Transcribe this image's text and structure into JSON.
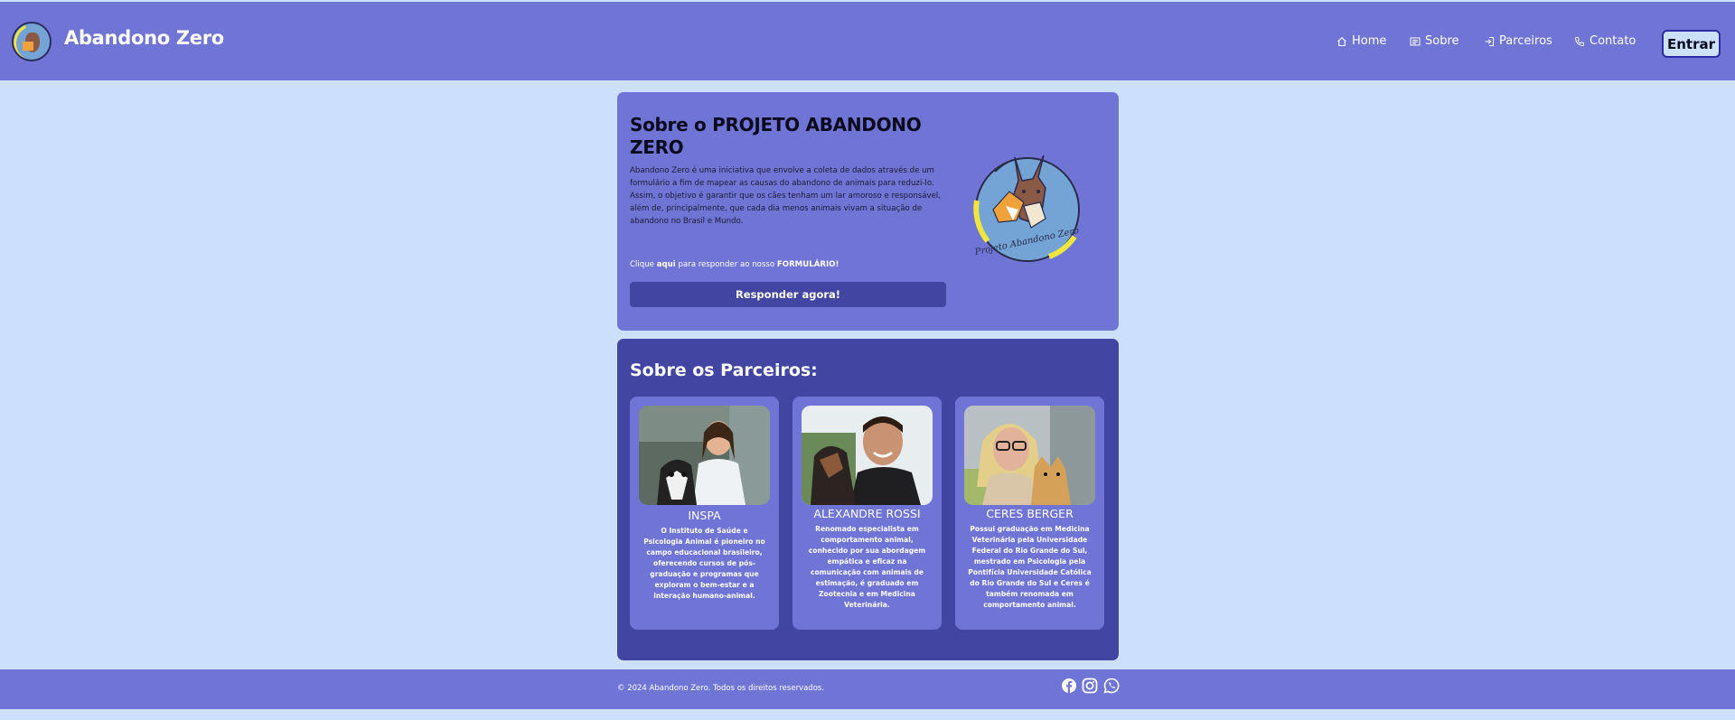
{
  "header": {
    "brand": "Abandono Zero",
    "nav": [
      {
        "label": "Home",
        "icon": "home-icon"
      },
      {
        "label": "Sobre",
        "icon": "list-icon"
      },
      {
        "label": "Parceiros",
        "icon": "login-icon"
      },
      {
        "label": "Contato",
        "icon": "phone-icon"
      }
    ],
    "login_label": "Entrar"
  },
  "about": {
    "title": "Sobre o PROJETO ABANDONO ZERO",
    "text": "Abandono Zero é uma iniciativa que envolve a coleta de dados através de um formulário a fim de mapear as causas do abandono de animais para reduzi-lo. Assim, o objetivo é garantir que os cães tenham um lar amoroso e responsável, além de, principalmente, que cada dia menos animais vivam a situação de abandono no Brasil e Mundo.",
    "cta_prefix": "Clique ",
    "cta_link": "aqui",
    "cta_middle": " para responder ao nosso ",
    "cta_form": "FORMULÁRIO!",
    "button_label": "Responder agora!",
    "logo_text": "Projeto Abandono Zero"
  },
  "partners": {
    "title": "Sobre os Parceiros:",
    "cards": [
      {
        "name": "INSPA",
        "description": "O Instituto de Saúde e Psicologia Animal é pioneiro no campo educacional brasileiro, oferecendo cursos de pós-graduação e programas que exploram o bem-estar e a interação humano-animal."
      },
      {
        "name": "ALEXANDRE ROSSI",
        "description": "Renomado especialista em comportamento animal, conhecido por sua abordagem empática e eficaz na comunicação com animais de estimação, é graduado em Zootecnia e em Medicina Veterinária."
      },
      {
        "name": "CERES BERGER",
        "description": "Possui graduação em Medicina Veterinária pela Universidade Federal do Rio Grande do Sul, mestrado em Psicologia pela Pontifícia Universidade Católica do Rio Grande do Sul e Ceres é também renomada em comportamento animal."
      }
    ]
  },
  "footer": {
    "copyright": "© 2024 Abandono Zero. Todos os direitos reservados.",
    "social": [
      "facebook-icon",
      "instagram-icon",
      "whatsapp-icon"
    ]
  },
  "colors": {
    "page_bg": "#cce0fd",
    "primary": "#7074d4",
    "dark": "#4345a3",
    "accent_yellow": "#f2e53f"
  }
}
